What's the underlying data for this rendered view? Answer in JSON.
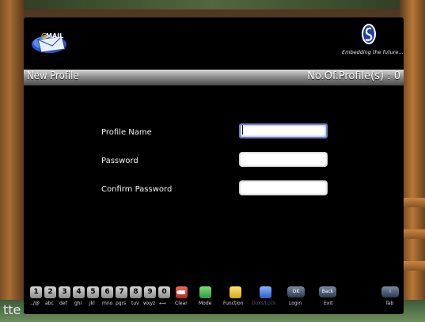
{
  "background": {
    "channel_text": "tte"
  },
  "brand": {
    "tagline": "Embedding the future..."
  },
  "title_bar": {
    "title": "New Profile",
    "profile_count": "No.Of.Profile(s) : 0"
  },
  "form": {
    "profile_name_label": "Profile Name",
    "password_label": "Password",
    "confirm_password_label": "Confirm Password",
    "profile_name_value": "",
    "password_value": "",
    "confirm_password_value": ""
  },
  "keypad": [
    {
      "key": "1",
      "label": ".,/@"
    },
    {
      "key": "2",
      "label": "abc"
    },
    {
      "key": "3",
      "label": "def"
    },
    {
      "key": "4",
      "label": "ghi"
    },
    {
      "key": "5",
      "label": "jkl"
    },
    {
      "key": "6",
      "label": "mno"
    },
    {
      "key": "7",
      "label": "pqrs"
    },
    {
      "key": "8",
      "label": "tuv"
    },
    {
      "key": "9",
      "label": "wxyz"
    },
    {
      "key": "0",
      "label": "⟷"
    }
  ],
  "actions": {
    "clear_label": "Clear",
    "mode_label": "Mode",
    "function_label": "Function",
    "blue_label": "Ooxs/Lock",
    "ok_key": "OK",
    "login_label": "Login",
    "back_key": "Back",
    "exit_label": "Exit",
    "tab_key": "i",
    "tab_label": "Tab"
  },
  "colors": {
    "panel": "#000000",
    "clear": "#d43a2a",
    "mode": "#3fb24a",
    "function": "#e8c42a",
    "blue": "#3a78d8"
  }
}
